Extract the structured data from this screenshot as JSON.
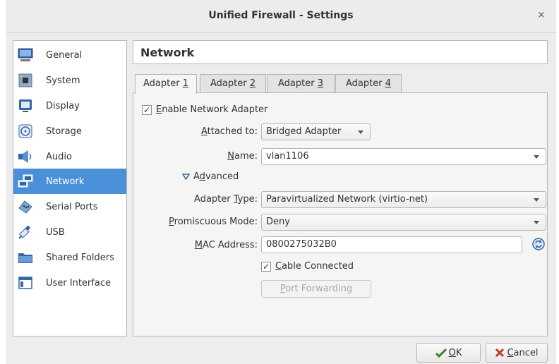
{
  "window": {
    "title": "Unified Firewall - Settings",
    "close_glyph": "×"
  },
  "sidebar": {
    "items": [
      {
        "label": "General",
        "icon": "monitor-icon"
      },
      {
        "label": "System",
        "icon": "chip-icon"
      },
      {
        "label": "Display",
        "icon": "display-icon"
      },
      {
        "label": "Storage",
        "icon": "disk-icon"
      },
      {
        "label": "Audio",
        "icon": "speaker-icon"
      },
      {
        "label": "Network",
        "icon": "network-icon",
        "active": true
      },
      {
        "label": "Serial Ports",
        "icon": "serial-port-icon"
      },
      {
        "label": "USB",
        "icon": "usb-icon"
      },
      {
        "label": "Shared Folders",
        "icon": "folder-icon"
      },
      {
        "label": "User Interface",
        "icon": "window-icon"
      }
    ]
  },
  "page": {
    "title": "Network"
  },
  "tabs": [
    {
      "text": "Adapter ",
      "mnemonic": "1"
    },
    {
      "text": "Adapter ",
      "mnemonic": "2"
    },
    {
      "text": "Adapter ",
      "mnemonic": "3"
    },
    {
      "text": "Adapter ",
      "mnemonic": "4"
    }
  ],
  "adapter": {
    "enable": {
      "mnemonic": "E",
      "rest": "nable Network Adapter",
      "checked": true
    },
    "attached_to": {
      "label_pre": "",
      "mnemonic": "A",
      "label_post": "ttached to:",
      "value": "Bridged Adapter"
    },
    "name": {
      "label_pre": "",
      "mnemonic": "N",
      "label_post": "ame:",
      "value": "vlan1106"
    },
    "advanced": {
      "pre": "A",
      "mnemonic": "d",
      "post": "vanced",
      "expanded": true
    },
    "adapter_type": {
      "label_pre": "Adapter ",
      "mnemonic": "T",
      "label_post": "ype:",
      "value": "Paravirtualized Network (virtio-net)"
    },
    "promiscuous": {
      "label_pre": "",
      "mnemonic": "P",
      "label_post": "romiscuous Mode:",
      "value": "Deny"
    },
    "mac": {
      "label_pre": "",
      "mnemonic": "M",
      "label_post": "AC Address:",
      "value": "0800275032B0"
    },
    "cable": {
      "mnemonic": "C",
      "rest": "able Connected",
      "checked": true
    },
    "port_forwarding": {
      "mnemonic": "P",
      "rest": "ort Forwarding"
    }
  },
  "buttons": {
    "ok": {
      "mnemonic": "O",
      "rest": "K"
    },
    "cancel": {
      "mnemonic": "C",
      "rest": "ancel"
    }
  },
  "colors": {
    "accent": "#4a90d9",
    "ok_icon": "#3d7f2e",
    "cancel_icon": "#c0392b"
  }
}
